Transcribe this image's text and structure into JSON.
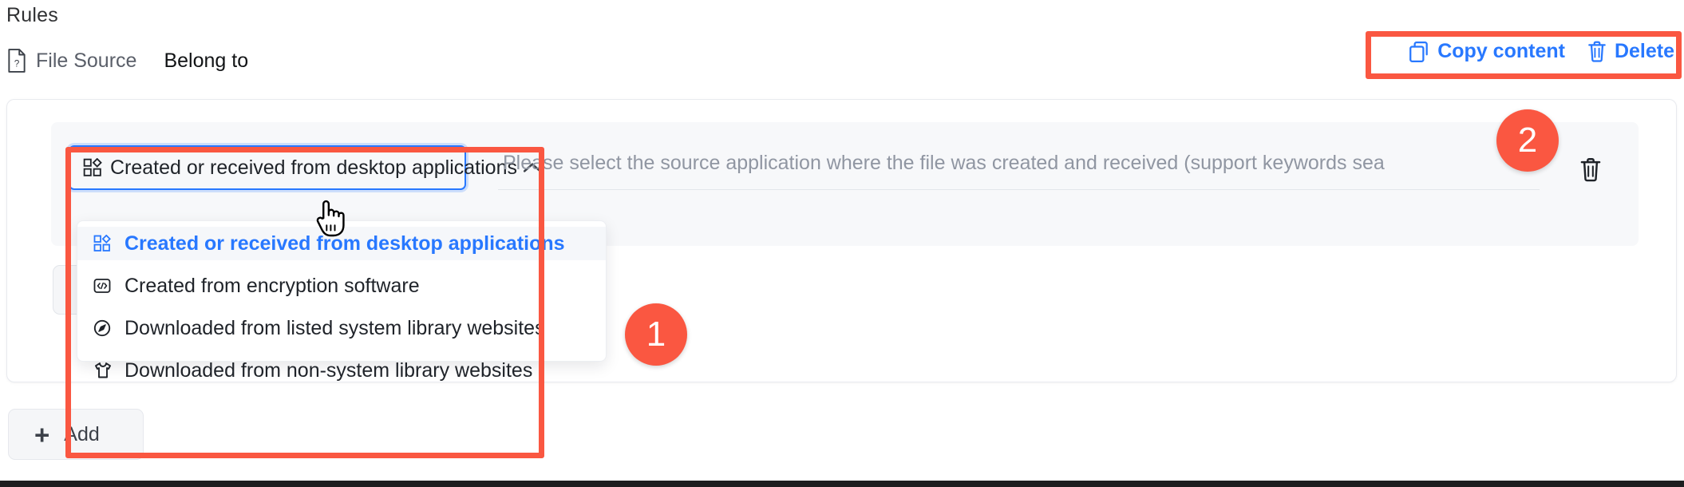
{
  "page": {
    "title": "Rules"
  },
  "tabs": [
    {
      "label": "File Source",
      "icon": "file-question-icon",
      "active": false
    },
    {
      "label": "Belong to",
      "icon": "",
      "active": true
    }
  ],
  "actions": [
    {
      "label": "Copy content",
      "icon": "copy-icon"
    },
    {
      "label": "Delete",
      "icon": "trash-icon"
    }
  ],
  "rule_row": {
    "select": {
      "value": "Created or received from desktop applications",
      "icon": "apps-grid-icon",
      "expanded": true,
      "caret": "chevron-up-icon"
    },
    "keyword_input": {
      "value": "",
      "placeholder": "Please select the source application where the file was created and received (support keywords sea"
    },
    "delete_icon": "trash-icon"
  },
  "dropdown": {
    "options": [
      {
        "label": "Created or received from desktop applications",
        "icon": "apps-grid-icon",
        "selected": true
      },
      {
        "label": "Created from encryption software",
        "icon": "code-box-icon",
        "selected": false
      },
      {
        "label": "Downloaded from listed system library websites",
        "icon": "compass-icon",
        "selected": false
      },
      {
        "label": "Downloaded from non-system library websites",
        "icon": "tshirt-icon",
        "selected": false
      }
    ]
  },
  "add_button": {
    "label": "Add",
    "plus": "+",
    "icon": "plus-icon"
  },
  "annotations": [
    {
      "id": "1",
      "target": "dropdown"
    },
    {
      "id": "2",
      "target": "actions"
    }
  ],
  "colors": {
    "accent_blue": "#2878ff",
    "annotation_red": "#fa5741",
    "text_primary": "#1f2329",
    "text_muted": "#9096a2",
    "panel_bg": "#f7f8fa"
  }
}
